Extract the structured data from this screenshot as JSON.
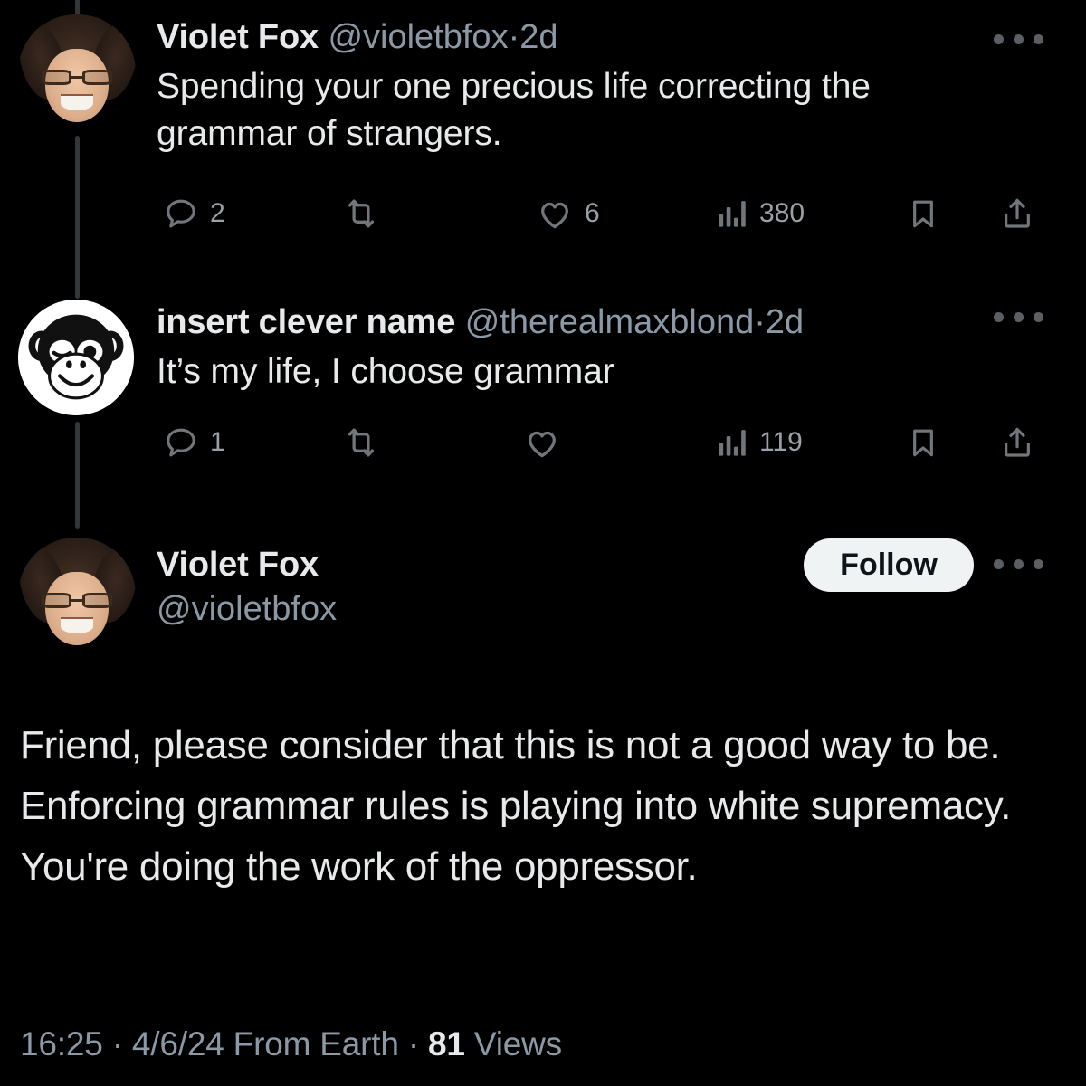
{
  "theme": {
    "background": "#000000",
    "text_primary": "#e7e9ea",
    "text_secondary": "#8b98a5",
    "icon_muted": "#71767b",
    "rail": "#333639",
    "follow_bg": "#eff3f4",
    "follow_text": "#0f1419"
  },
  "thread": {
    "tweets": [
      {
        "id": "tweet-1",
        "author": {
          "display_name": "Violet Fox",
          "handle": "@violetbfox",
          "avatar": "photo-avatar-violet-fox"
        },
        "separator": "·",
        "age": "2d",
        "text": "Spending your one precious life correcting the grammar of strangers.",
        "more_label": "More",
        "actions": {
          "reply": {
            "icon": "reply-icon",
            "count": "2"
          },
          "retweet": {
            "icon": "retweet-icon",
            "count": ""
          },
          "like": {
            "icon": "heart-icon",
            "count": "6"
          },
          "views": {
            "icon": "views-bar-chart-icon",
            "count": "380"
          },
          "bookmark": {
            "icon": "bookmark-icon",
            "count": ""
          },
          "share": {
            "icon": "share-upload-icon",
            "count": ""
          }
        }
      },
      {
        "id": "tweet-2",
        "author": {
          "display_name": "insert clever name",
          "handle": "@therealmaxblond",
          "avatar": "monkey-avatar"
        },
        "separator": "·",
        "age": "2d",
        "text": "It’s my life, I choose grammar",
        "more_label": "More",
        "actions": {
          "reply": {
            "icon": "reply-icon",
            "count": "1"
          },
          "retweet": {
            "icon": "retweet-icon",
            "count": ""
          },
          "like": {
            "icon": "heart-icon",
            "count": ""
          },
          "views": {
            "icon": "views-bar-chart-icon",
            "count": "119"
          },
          "bookmark": {
            "icon": "bookmark-icon",
            "count": ""
          },
          "share": {
            "icon": "share-upload-icon",
            "count": ""
          }
        }
      },
      {
        "id": "tweet-3-focused",
        "author": {
          "display_name": "Violet Fox",
          "handle": "@violetbfox",
          "avatar": "photo-avatar-violet-fox"
        },
        "follow_label": "Follow",
        "more_label": "More",
        "text": "Friend, please consider that this is not a good way to be. Enforcing grammar rules is playing into white supremacy. You're doing the work of the oppressor."
      }
    ]
  },
  "footer": {
    "time": "16:25",
    "dot_1": "·",
    "date": "4/6/24",
    "source": "From Earth",
    "dot_2": "·",
    "views_count": "81",
    "views_label": "Views"
  }
}
